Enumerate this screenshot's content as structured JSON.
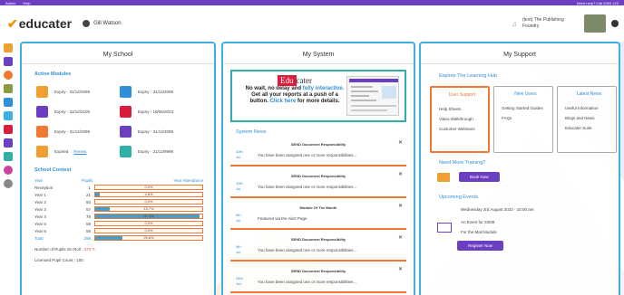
{
  "topbar": {
    "left_items": [
      "Admin",
      "Help"
    ],
    "right_text": "Need help? Call 0300 123"
  },
  "header": {
    "logo_text": "educater",
    "school_name": "Gill Watson",
    "user_line1": "(test) The Publishing",
    "user_line2": "Foundry"
  },
  "my_school": {
    "title": "My School",
    "active_modules_title": "Active Modules",
    "modules": [
      {
        "icon": "planner-icon",
        "text": "Expiry - 31/12/2099",
        "color": "#f0a030"
      },
      {
        "icon": "book-icon",
        "text": "Expiry - 31/12/2099",
        "color": "#2f8fd8"
      },
      {
        "icon": "hand-icon",
        "text": "Expiry - 31/12/2100",
        "color": "#6a3fc2"
      },
      {
        "icon": "certificate-icon",
        "text": "Expiry - 19/06/2023",
        "color": "#d81e3c"
      },
      {
        "icon": "target-icon",
        "text": "Expiry - 31/12/2099",
        "color": "#f07830"
      },
      {
        "icon": "mail-icon",
        "text": "Expiry - 31/12/2099",
        "color": "#6a3fc2"
      },
      {
        "icon": "gear-icon",
        "text": "Expired",
        "link": "Renew",
        "color": "#f0a030"
      },
      {
        "icon": "bridge-icon",
        "text": "Expiry - 31/12/9999",
        "color": "#2eb0a8"
      }
    ],
    "context_title": "School Context",
    "table_headers": {
      "year": "Year",
      "pupils": "Pupils",
      "attendance": "Year Attendance"
    },
    "rows": [
      {
        "year": "Reception",
        "pupils": "1",
        "pct_label": "0.0%",
        "pct": 0.0
      },
      {
        "year": "Year 1",
        "pupils": "21",
        "pct_label": "4.6%",
        "pct": 4.6
      },
      {
        "year": "Year 2",
        "pupils": "50",
        "pct_label": "0.0%",
        "pct": 0.0
      },
      {
        "year": "Year 3",
        "pupils": "57",
        "pct_label": "13.7%",
        "pct": 13.7
      },
      {
        "year": "Year 4",
        "pupils": "79",
        "pct_label": "97.3%",
        "pct": 97.3
      },
      {
        "year": "Year 5",
        "pupils": "59",
        "pct_label": "0.0%",
        "pct": 0.0
      },
      {
        "year": "Year 6",
        "pupils": "59",
        "pct_label": "0.0%",
        "pct": 0.0
      },
      {
        "year": "Total",
        "pupils": "298",
        "pct_label": "25.6%",
        "pct": 25.6
      }
    ],
    "pupils_on_roll_label": "Number of Pupils On Roll :",
    "pupils_on_roll_value": "473",
    "licensed_count": "Licensed Pupil Count : 100"
  },
  "my_system": {
    "title": "My System",
    "banner": {
      "brand_1": "Edu",
      "brand_2": "cater",
      "line1_a": "No wait, no delay and ",
      "line1_b": "fully interactive.",
      "line2": "Get all your reports at a push of a",
      "line3_a": "button. ",
      "line3_b": "Click here",
      "line3_c": " for more details."
    },
    "news_title": "System News",
    "news": [
      {
        "title": "SEND Document Responsibility",
        "day": "10th",
        "month": "Jul",
        "body": "You have been assigned one or more responsibilities..."
      },
      {
        "title": "SEND Document Responsibility",
        "day": "10th",
        "month": "Jul",
        "body": "You have been assigned one or more responsibilities..."
      },
      {
        "title": "Module Of The Month",
        "day": "5th",
        "month": "Jul",
        "body": "Featured via the Alert Page"
      },
      {
        "title": "SEND Document Responsibility",
        "day": "5th",
        "month": "Jul",
        "body": "You have been assigned one or more responsibilities..."
      },
      {
        "title": "SEND Document Responsibility",
        "day": "24th",
        "month": "Jun",
        "body": "You have been assigned one or more responsibilities..."
      }
    ]
  },
  "my_support": {
    "title": "My Support",
    "hub_title": "Explore The Learning Hub",
    "columns": [
      {
        "heading": "User Support",
        "links": [
          "Help Sheets",
          "Video Walkthrough",
          "Customer Webinars"
        ]
      },
      {
        "heading": "New Users",
        "links": [
          "Getting Started Guides",
          "FAQs"
        ]
      },
      {
        "heading": "Latest News",
        "links": [
          "Useful Information",
          "Blogs and News",
          "Educater Suite"
        ]
      }
    ],
    "training_title": "Need More Training?",
    "book_now": "Book Now",
    "events_title": "Upcoming Events",
    "event_date": "Wednesday 3rd August 2022 - 10:00 am",
    "event_name": "An Event for 03/08",
    "event_module": "For the Mail Module",
    "register_now": "Register Now"
  },
  "colors": {
    "brand_purple": "#6a3fc2",
    "panel_border": "#40b0e0",
    "accent_orange": "#f07830",
    "link_blue": "#2f8fd8"
  }
}
